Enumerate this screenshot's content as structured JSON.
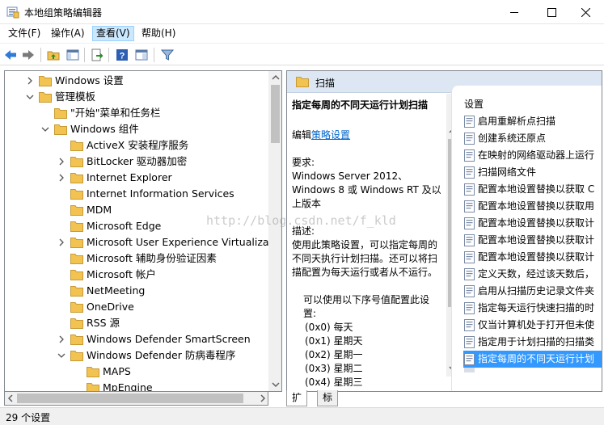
{
  "window": {
    "title": "本地组策略编辑器",
    "minimize_icon": "minimize-icon",
    "maximize_icon": "maximize-icon",
    "close_icon": "close-icon"
  },
  "menu": [
    "文件(F)",
    "操作(A)",
    "查看(V)",
    "帮助(H)"
  ],
  "toolbar": [
    "back-arrow-icon",
    "forward-arrow-icon",
    "up-folder-icon",
    "show-hide-tree-icon",
    "export-list-icon",
    "help-icon",
    "properties-pane-icon",
    "filter-icon"
  ],
  "tree": [
    {
      "label": "Windows 设置",
      "depth": 1,
      "chevron": "right"
    },
    {
      "label": "管理模板",
      "depth": 1,
      "chevron": "down"
    },
    {
      "label": "\"开始\"菜单和任务栏",
      "depth": 2,
      "chevron": "none"
    },
    {
      "label": "Windows 组件",
      "depth": 2,
      "chevron": "down"
    },
    {
      "label": "ActiveX 安装程序服务",
      "depth": 3,
      "chevron": "none"
    },
    {
      "label": "BitLocker 驱动器加密",
      "depth": 3,
      "chevron": "right"
    },
    {
      "label": "Internet Explorer",
      "depth": 3,
      "chevron": "right"
    },
    {
      "label": "Internet Information Services",
      "depth": 3,
      "chevron": "none"
    },
    {
      "label": "MDM",
      "depth": 3,
      "chevron": "none"
    },
    {
      "label": "Microsoft Edge",
      "depth": 3,
      "chevron": "none"
    },
    {
      "label": "Microsoft User Experience Virtualizatio",
      "depth": 3,
      "chevron": "right"
    },
    {
      "label": "Microsoft 辅助身份验证因素",
      "depth": 3,
      "chevron": "none"
    },
    {
      "label": "Microsoft 帐户",
      "depth": 3,
      "chevron": "none"
    },
    {
      "label": "NetMeeting",
      "depth": 3,
      "chevron": "none"
    },
    {
      "label": "OneDrive",
      "depth": 3,
      "chevron": "none"
    },
    {
      "label": "RSS 源",
      "depth": 3,
      "chevron": "none"
    },
    {
      "label": "Windows Defender SmartScreen",
      "depth": 3,
      "chevron": "right"
    },
    {
      "label": "Windows Defender 防病毒程序",
      "depth": 3,
      "chevron": "down"
    },
    {
      "label": "MAPS",
      "depth": 4,
      "chevron": "none"
    },
    {
      "label": "MpEngine",
      "depth": 4,
      "chevron": "none"
    }
  ],
  "right_header": {
    "title": "扫描"
  },
  "description": {
    "title": "指定每周的不同天运行计划扫描",
    "edit_prefix": "编辑",
    "edit_link": "策略设置",
    "req_label": "要求:",
    "req_lines": [
      "Windows Server 2012、",
      "Windows 8 或 Windows RT 及以",
      "上版本"
    ],
    "desc_label": "描述:",
    "desc_lines": [
      "使用此策略设置，可以指定每周的",
      "不同天执行计划扫描。还可以将扫",
      "描配置为每天运行或者从不运行。"
    ],
    "values_intro": "可以使用以下序号值配置此设",
    "values_intro2": "置:",
    "values": [
      "(0x0) 每天",
      "(0x1) 星期天",
      "(0x2) 星期一",
      "(0x3) 星期二",
      "(0x4) 星期三"
    ]
  },
  "policy_list": {
    "header": "设置",
    "items": [
      "启用重解析点扫描",
      "创建系统还原点",
      "在映射的网络驱动器上运行",
      "扫描网络文件",
      "配置本地设置替换以获取 C",
      "配置本地设置替换以获取用",
      "配置本地设置替换以获取计",
      "配置本地设置替换以获取计",
      "配置本地设置替换以获取计",
      "定义天数，经过该天数后，",
      "启用从扫描历史记录文件夹",
      "指定每天运行快速扫描的时",
      "仅当计算机处于打开但未使",
      "指定用于计划扫描的扫描类",
      "指定每周的不同天运行计划"
    ],
    "selected_index": 14
  },
  "tabs": [
    "扩展",
    "标准"
  ],
  "status": "29 个设置",
  "watermark": "http://blog.csdn.net/f_kld",
  "colors": {
    "selection": "#3399ff",
    "folder": "#f2c350",
    "header_bg": "#dde7f3",
    "menu_active": "#cce8ff"
  }
}
